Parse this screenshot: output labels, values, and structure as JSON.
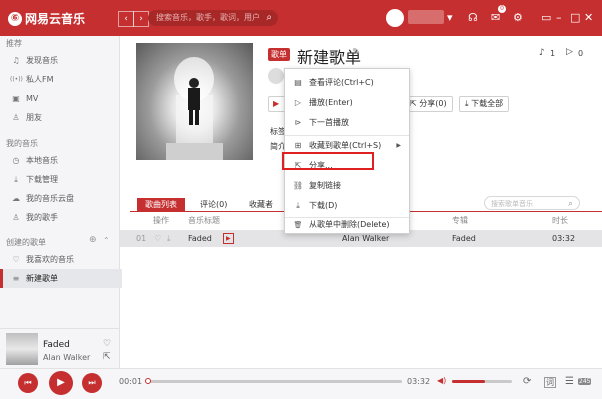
{
  "app": {
    "logo_text": "网易云音乐",
    "logo_mark": "⑥"
  },
  "titlebar": {
    "back_icon": "‹",
    "forward_icon": "›",
    "search_placeholder": "搜索音乐，歌手，歌词，用户",
    "search_icon": "⌕",
    "icons": [
      "▾",
      "☊",
      "✉",
      "⚙",
      "▭",
      "–",
      "□",
      "✕"
    ],
    "msg_badge": "0"
  },
  "sidebar": {
    "section_recommend": "推荐",
    "recommend_items": [
      {
        "icon": "♫",
        "label": "发现音乐"
      },
      {
        "icon": "((•))",
        "label": "私人FM"
      },
      {
        "icon": "▣",
        "label": "MV"
      },
      {
        "icon": "♙",
        "label": "朋友"
      }
    ],
    "section_mymusic": "我的音乐",
    "mymusic_items": [
      {
        "icon": "◷",
        "label": "本地音乐"
      },
      {
        "icon": "⤓",
        "label": "下载管理"
      },
      {
        "icon": "☁",
        "label": "我的音乐云盘"
      },
      {
        "icon": "♙",
        "label": "我的歌手"
      }
    ],
    "section_created": "创建的歌单",
    "created_add": "⊕",
    "created_toggle": "⌃",
    "created_items": [
      {
        "icon": "♡",
        "label": "我喜欢的音乐"
      },
      {
        "icon": "≡",
        "label": "新建歌单"
      }
    ]
  },
  "now_playing": {
    "title": "Faded",
    "artist": "Alan Walker",
    "like_icon": "♡",
    "share_icon": "⇱"
  },
  "playlist": {
    "tag": "歌单",
    "title": "新建歌单",
    "edit_icon": "✎",
    "song_count_icon": "♪",
    "song_count": "1",
    "play_count_icon": "▷",
    "play_count": "0",
    "tag_label": "标签",
    "intro_label": "简介",
    "buttons": [
      {
        "icon": "⇱",
        "label": "分享(0)"
      },
      {
        "icon": "⤓",
        "label": "下载全部"
      }
    ]
  },
  "tabs": [
    "歌曲列表",
    "评论(0)",
    "收藏者"
  ],
  "playlist_search_placeholder": "搜索歌单音乐",
  "table": {
    "headers": [
      "操作",
      "音乐标题",
      "专辑",
      "时长"
    ],
    "artist_header": "歌手",
    "rows": [
      {
        "index": "01",
        "title": "Faded",
        "mv": "▶",
        "artist": "Alan Walker",
        "album": "Faded",
        "duration": "03:32"
      }
    ]
  },
  "context_menu": [
    {
      "icon": "▤",
      "label": "查看评论(Ctrl+C)"
    },
    {
      "icon": "▷",
      "label": "播放(Enter)"
    },
    {
      "icon": "⊳",
      "label": "下一首播放"
    },
    {
      "icon": "⊞",
      "label": "收藏到歌单(Ctrl+S)",
      "arrow": "▶"
    },
    {
      "icon": "⇱",
      "label": "分享..."
    },
    {
      "icon": "⛓",
      "label": "复制链接"
    },
    {
      "icon": "⤓",
      "label": "下载(D)"
    },
    {
      "icon": "🗑",
      "label": "从歌单中删除(Delete)"
    }
  ],
  "player": {
    "prev_icon": "⏮",
    "play_icon": "▶",
    "next_icon": "⏭",
    "elapsed": "00:01",
    "total": "03:32",
    "progress_fraction": 0.005,
    "volume_icon": "◀)",
    "volume_fraction": 0.55,
    "mode_icon": "⟳",
    "lyric_icon": "词",
    "list_icon": "☰",
    "list_count": "245"
  },
  "colors": {
    "brand_red": "#c62f2f",
    "highlight_red": "#e02020"
  }
}
